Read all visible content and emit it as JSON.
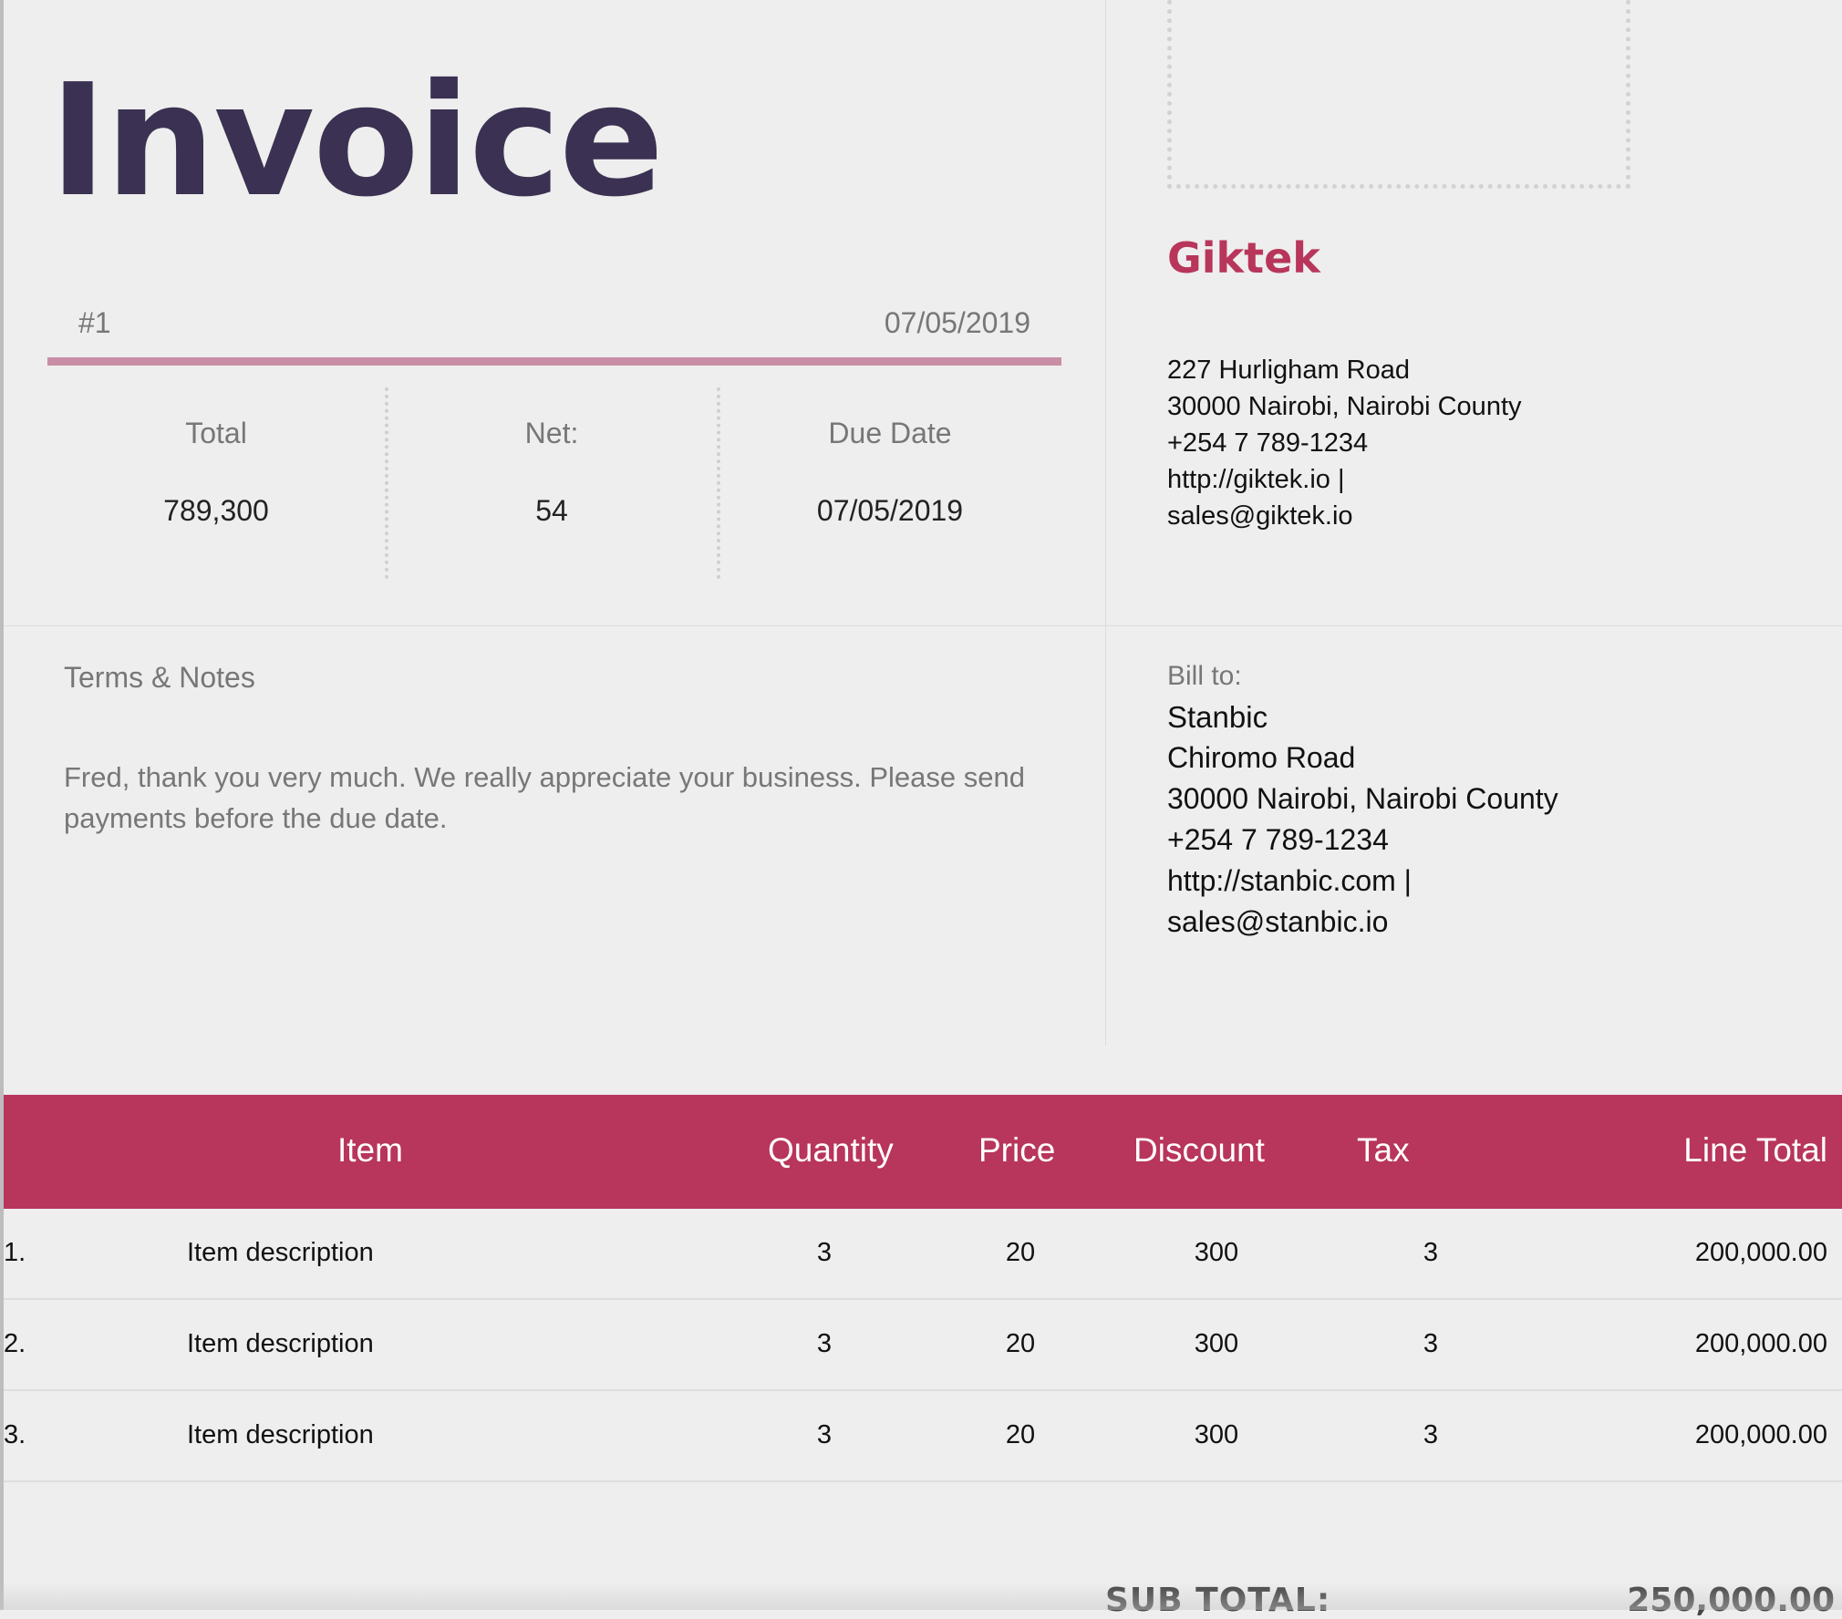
{
  "header": {
    "title": "Invoice",
    "invoice_number": "#1",
    "invoice_date": "07/05/2019"
  },
  "summary": {
    "total_label": "Total",
    "total_value": "789,300",
    "net_label": "Net:",
    "net_value": "54",
    "due_label": "Due Date",
    "due_value": "07/05/2019"
  },
  "company": {
    "name": "Giktek",
    "address_line1": "227 Hurligham Road",
    "address_line2": "30000 Nairobi, Nairobi County",
    "phone": "+254 7 789-1234",
    "website": "http://giktek.io |",
    "email": "sales@giktek.io"
  },
  "terms": {
    "label": "Terms & Notes",
    "text": "Fred, thank you very much. We really appreciate your business. Please send payments before the due date."
  },
  "bill_to": {
    "label": "Bill to:",
    "name": "Stanbic",
    "address_line1": "Chiromo Road",
    "address_line2": "30000 Nairobi, Nairobi County",
    "phone": "+254 7 789-1234",
    "website": "http://stanbic.com |",
    "email": "sales@stanbic.io"
  },
  "table": {
    "columns": [
      "Item",
      "Quantity",
      "Price",
      "Discount",
      "Tax",
      "Line Total"
    ],
    "rows": [
      {
        "index": "1.",
        "item": "Item description",
        "quantity": "3",
        "price": "20",
        "discount": "300",
        "tax": "3",
        "line_total": "200,000.00"
      },
      {
        "index": "2.",
        "item": "Item description",
        "quantity": "3",
        "price": "20",
        "discount": "300",
        "tax": "3",
        "line_total": "200,000.00"
      },
      {
        "index": "3.",
        "item": "Item description",
        "quantity": "3",
        "price": "20",
        "discount": "300",
        "tax": "3",
        "line_total": "200,000.00"
      }
    ]
  },
  "totals": {
    "subtotal_label": "SUB TOTAL:",
    "subtotal_value": "250,000.00"
  },
  "colors": {
    "title": "#3b3152",
    "accent": "#b8355b",
    "rule": "#c98ea5",
    "background": "#eeeeee"
  }
}
